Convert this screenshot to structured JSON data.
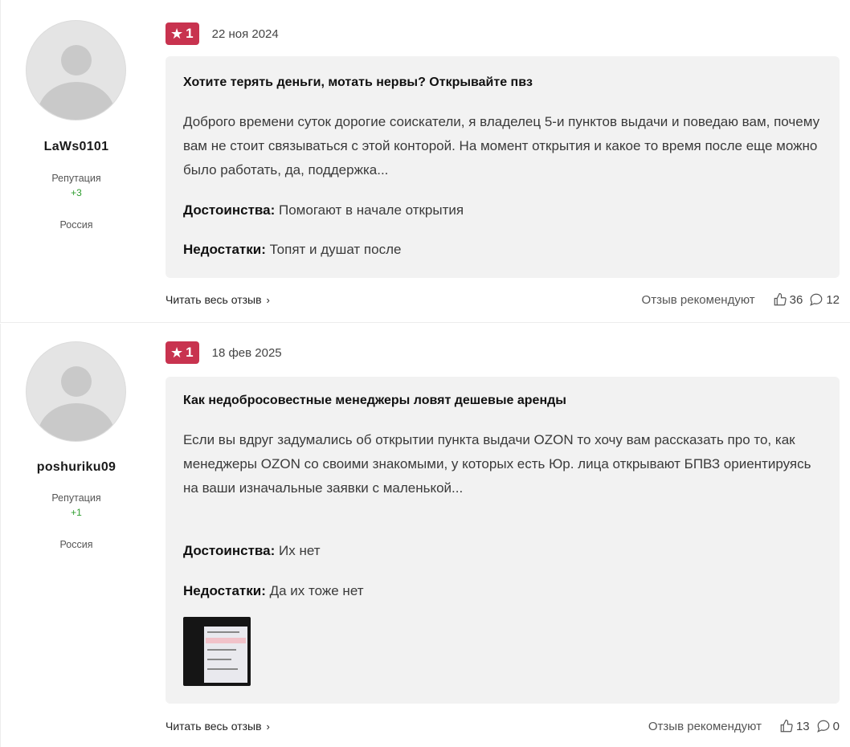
{
  "reviews": [
    {
      "author": {
        "username": "LaWs0101",
        "reputation_label": "Репутация",
        "reputation_value": "+3",
        "country": "Россия"
      },
      "rating": "1",
      "date": "22 ноя 2024",
      "title": "Хотите терять деньги, мотать нервы? Открывайте пвз",
      "text": "Доброго времени суток дорогие соискатели, я владелец 5-и пунктов выдачи и поведаю вам, почему вам не стоит связываться с этой конторой. На момент открытия и какое то время после еще можно было работать, да, поддержка...",
      "pros_label": "Достоинства:",
      "pros": "Помогают в начале открытия",
      "cons_label": "Недостатки:",
      "cons": "Топят и душат после",
      "read_more": "Читать весь отзыв",
      "recommend_label": "Отзыв рекомендуют",
      "likes": "36",
      "comments": "12"
    },
    {
      "author": {
        "username": "poshuriku09",
        "reputation_label": "Репутация",
        "reputation_value": "+1",
        "country": "Россия"
      },
      "rating": "1",
      "date": "18 фев 2025",
      "title": "Как недобросовестные менеджеры ловят дешевые аренды",
      "text": "Если вы вдруг задумались об открытии пункта выдачи OZON то хочу вам рассказать про то, как менеджеры OZON со своими знакомыми, у которых есть Юр. лица открывают БПВЗ ориентируясь на ваши изначальные заявки с маленькой...",
      "pros_label": "Достоинства:",
      "pros": "Их нет",
      "cons_label": "Недостатки:",
      "cons": "Да их тоже нет",
      "read_more": "Читать весь отзыв",
      "recommend_label": "Отзыв рекомендуют",
      "likes": "13",
      "comments": "0"
    }
  ],
  "colors": {
    "rating_badge": "#c8334f",
    "reputation_positive": "#2e9d2e",
    "card_background": "#f2f2f2"
  },
  "icons": {
    "rating": "star-icon",
    "likes": "thumbs-up-icon",
    "comments": "comment-bubble-icon",
    "read_more": "chevron-right-icon"
  }
}
